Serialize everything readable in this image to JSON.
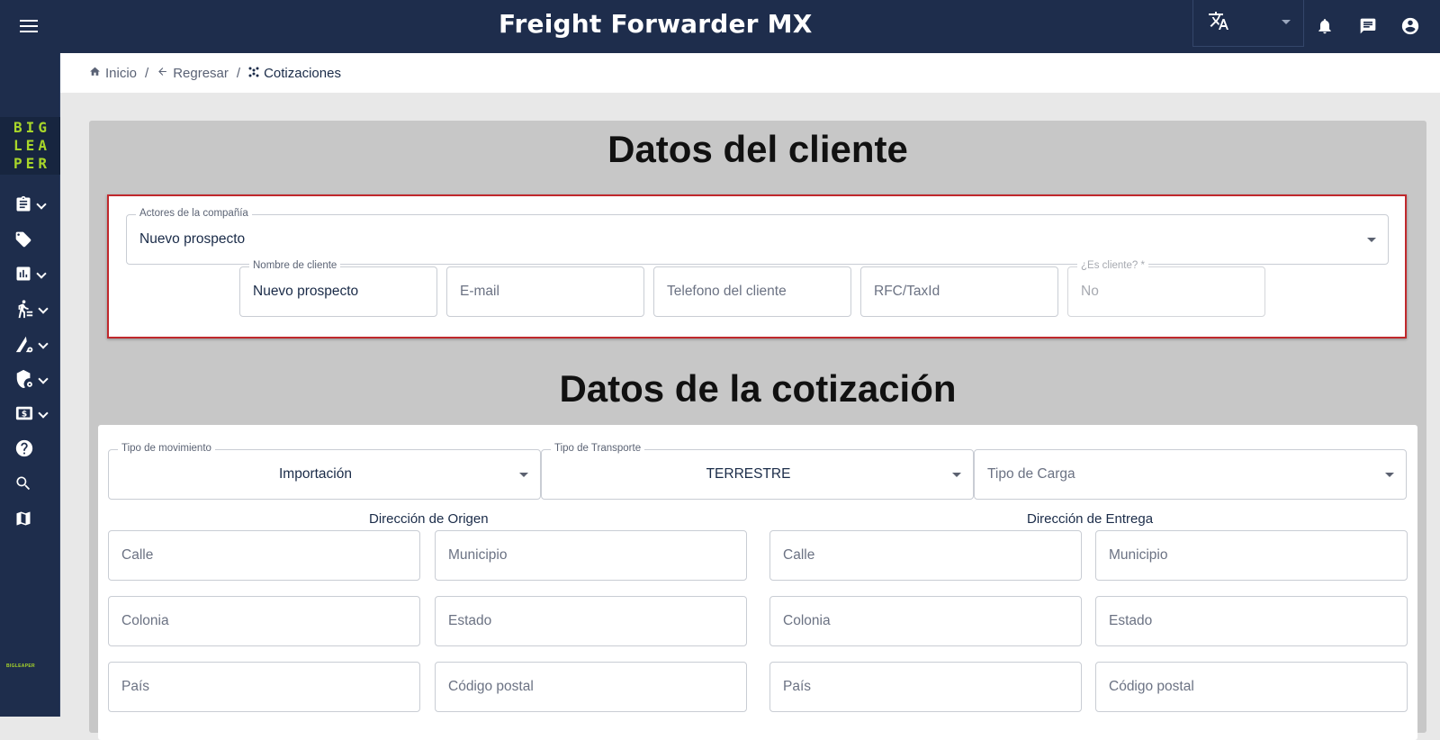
{
  "header": {
    "title": "Freight Forwarder MX"
  },
  "logo": {
    "lines": [
      "BIG",
      "LEA",
      "PER"
    ],
    "mini_text": "BIGLEAPER"
  },
  "breadcrumb": {
    "items": [
      "Inicio",
      "Regresar",
      "Cotizaciones"
    ],
    "separator": "/"
  },
  "client": {
    "heading": "Datos del cliente",
    "actors": {
      "label": "Actores de la compañía",
      "value": "Nuevo prospecto"
    },
    "name": {
      "label": "Nombre de cliente",
      "value": "Nuevo prospecto"
    },
    "email": {
      "placeholder": "E-mail"
    },
    "phone": {
      "placeholder": "Telefono del cliente"
    },
    "rfc": {
      "placeholder": "RFC/TaxId"
    },
    "is_client": {
      "label": "¿Es cliente? *",
      "value": "No"
    }
  },
  "quote": {
    "heading": "Datos de la cotización",
    "movement": {
      "label": "Tipo de movimiento",
      "value": "Importación"
    },
    "transport": {
      "label": "Tipo de Transporte",
      "value": "TERRESTRE"
    },
    "cargo": {
      "placeholder": "Tipo de Carga"
    },
    "origin": {
      "title": "Dirección de Origen",
      "street": "Calle",
      "municipality": "Municipio",
      "neighborhood": "Colonia",
      "state": "Estado",
      "country": "País",
      "zip": "Código postal"
    },
    "delivery": {
      "title": "Dirección de Entrega",
      "street": "Calle",
      "municipality": "Municipio",
      "neighborhood": "Colonia",
      "state": "Estado",
      "country": "País",
      "zip": "Código postal"
    }
  },
  "colors": {
    "navbar": "#1e2d4c",
    "highlight_border": "#c0282c",
    "logo_green": "#a8d62a",
    "panel_gray": "#c7c7c7"
  },
  "icons": [
    "menu-icon",
    "translate-icon",
    "bell-icon",
    "chat-icon",
    "account-icon",
    "home-icon",
    "arrow-left-icon",
    "dots-icon",
    "clipboard-icon",
    "tag-icon",
    "chart-icon",
    "walk-icon",
    "road-gear-icon",
    "shield-gear-icon",
    "dollar-icon",
    "help-icon",
    "search-icon",
    "map-icon"
  ]
}
